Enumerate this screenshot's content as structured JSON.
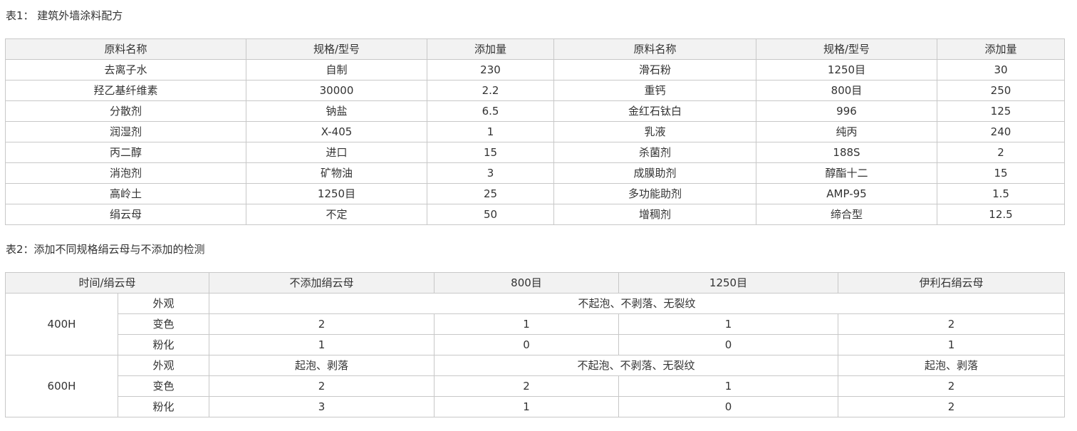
{
  "table1": {
    "caption": "表1： 建筑外墙涂料配方",
    "headers": [
      "原料名称",
      "规格/型号",
      "添加量",
      "原料名称",
      "规格/型号",
      "添加量"
    ],
    "rows": [
      [
        "去离子水",
        "自制",
        "230",
        "滑石粉",
        "1250目",
        "30"
      ],
      [
        "羟乙基纤维素",
        "30000",
        "2.2",
        "重钙",
        "800目",
        "250"
      ],
      [
        "分散剂",
        "钠盐",
        "6.5",
        "金红石钛白",
        "996",
        "125"
      ],
      [
        "润湿剂",
        "X-405",
        "1",
        "乳液",
        "纯丙",
        "240"
      ],
      [
        "丙二醇",
        "进口",
        "15",
        "杀菌剂",
        "188S",
        "2"
      ],
      [
        "消泡剂",
        "矿物油",
        "3",
        "成膜助剂",
        "醇酯十二",
        "15"
      ],
      [
        "高岭土",
        "1250目",
        "25",
        "多功能助剂",
        "AMP-95",
        "1.5"
      ],
      [
        "绢云母",
        "不定",
        "50",
        "增稠剂",
        "缔合型",
        "12.5"
      ]
    ]
  },
  "table2": {
    "caption": "表2：添加不同规格绢云母与不添加的检测",
    "headers": [
      "时间/绢云母",
      "不添加绢云母",
      "800目",
      "1250目",
      "伊利石绢云母"
    ],
    "groups": [
      {
        "time": "400H",
        "rows": [
          {
            "label": "外观",
            "merged": "不起泡、不剥落、无裂纹"
          },
          {
            "label": "变色",
            "values": [
              "2",
              "1",
              "1",
              "2"
            ]
          },
          {
            "label": "粉化",
            "values": [
              "1",
              "0",
              "0",
              "1"
            ]
          }
        ]
      },
      {
        "time": "600H",
        "rows": [
          {
            "label": "外观",
            "first": "起泡、剥落",
            "merged": "不起泡、不剥落、无裂纹",
            "last": "起泡、剥落"
          },
          {
            "label": "变色",
            "values": [
              "2",
              "2",
              "1",
              "2"
            ]
          },
          {
            "label": "粉化",
            "values": [
              "3",
              "1",
              "0",
              "2"
            ]
          }
        ]
      }
    ]
  }
}
